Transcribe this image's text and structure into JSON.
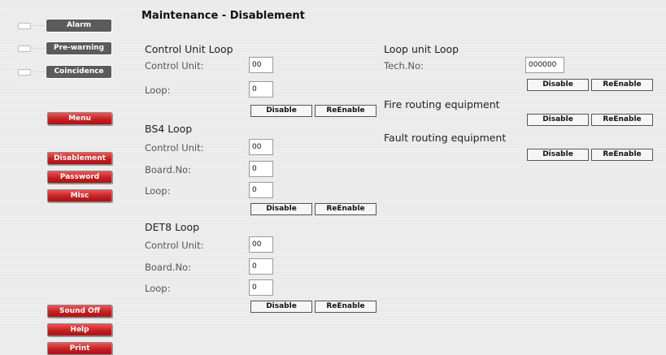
{
  "status": {
    "alarm": "Alarm",
    "prewarning": "Pre-warning",
    "coincidence": "Coincidence"
  },
  "sidebar": {
    "menu": "Menu",
    "disablement": "Disablement",
    "password": "Password",
    "misc": "Misc",
    "sound_off": "Sound Off",
    "help": "Help",
    "print": "Print"
  },
  "page_title": "Maintenance - Disablement",
  "control_unit_loop": {
    "title": "Control Unit Loop",
    "control_unit_label": "Control Unit:",
    "control_unit_value": "00",
    "loop_label": "Loop:",
    "loop_value": "0",
    "disable": "Disable",
    "reenable": "ReEnable"
  },
  "bs4_loop": {
    "title": "BS4 Loop",
    "control_unit_label": "Control Unit:",
    "control_unit_value": "00",
    "board_label": "Board.No:",
    "board_value": "0",
    "loop_label": "Loop:",
    "loop_value": "0",
    "disable": "Disable",
    "reenable": "ReEnable"
  },
  "det8_loop": {
    "title": "DET8 Loop",
    "control_unit_label": "Control Unit:",
    "control_unit_value": "00",
    "board_label": "Board.No:",
    "board_value": "0",
    "loop_label": "Loop:",
    "loop_value": "0",
    "disable": "Disable",
    "reenable": "ReEnable"
  },
  "loop_unit_loop": {
    "title": "Loop unit Loop",
    "tech_label": "Tech.No:",
    "tech_value": "000000",
    "disable": "Disable",
    "reenable": "ReEnable"
  },
  "fire_routing": {
    "title": "Fire routing equipment",
    "disable": "Disable",
    "reenable": "ReEnable"
  },
  "fault_routing": {
    "title": "Fault routing equipment",
    "disable": "Disable",
    "reenable": "ReEnable"
  }
}
